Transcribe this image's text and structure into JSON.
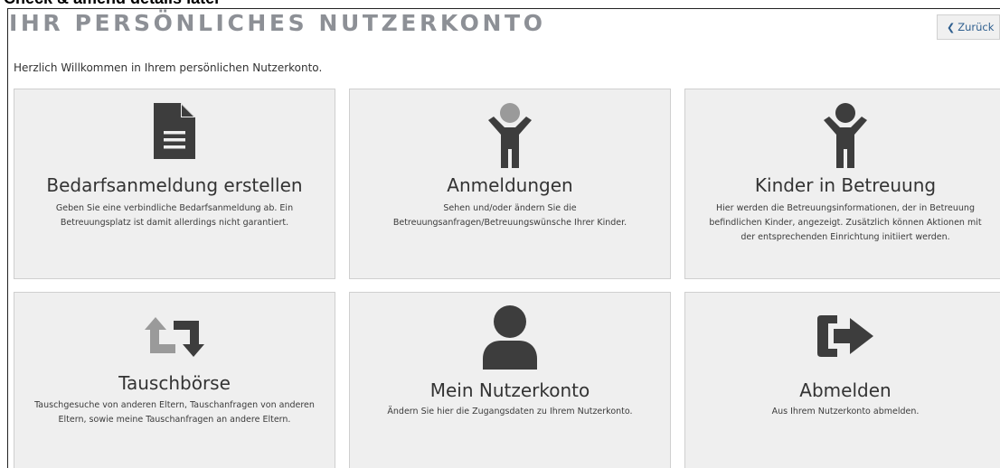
{
  "banner": {
    "text": "Check & amend details later"
  },
  "header": {
    "title": "IHR PERSÖNLICHES NUTZERKONTO",
    "back_label": "Zurück"
  },
  "welcome": "Herzlich Willkommen in Ihrem persönlichen Nutzerkonto.",
  "tiles": [
    {
      "icon": "document-icon",
      "title": "Bedarfsanmeldung erstellen",
      "desc": "Geben Sie eine verbindliche Bedarfsanmeldung ab. Ein Betreuungsplatz ist damit allerdings nicht garantiert."
    },
    {
      "icon": "child-icon",
      "title": "Anmeldungen",
      "desc": "Sehen und/oder ändern Sie die Betreuungsanfragen/Betreuungswünsche Ihrer Kinder."
    },
    {
      "icon": "child-icon",
      "title": "Kinder in Betreuung",
      "desc": "Hier werden die Betreuungsinformationen, der in Betreuung befindlichen Kinder, angezeigt. Zusätzlich können Aktionen mit der entsprechenden Einrichtung initiiert werden."
    },
    {
      "icon": "exchange-icon",
      "title": "Tauschbörse",
      "desc": "Tauschgesuche von anderen Eltern, Tauschanfragen von anderen Eltern, sowie meine Tauschanfragen an andere Eltern."
    },
    {
      "icon": "user-icon",
      "title": "Mein Nutzerkonto",
      "desc": "Ändern Sie hier die Zugangsdaten zu Ihrem Nutzerkonto."
    },
    {
      "icon": "sign-out-icon",
      "title": "Abmelden",
      "desc": "Aus Ihrem Nutzerkonto abmelden."
    }
  ]
}
